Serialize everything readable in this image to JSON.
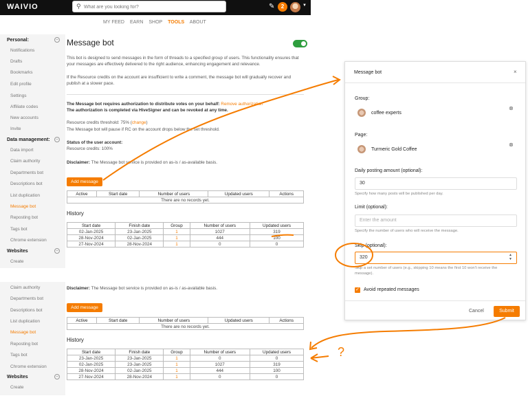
{
  "header": {
    "logo": "WAIVIO",
    "search_placeholder": "What are you looking for?",
    "notification_count": "2",
    "nav": [
      "MY FEED",
      "EARN",
      "SHOP",
      "TOOLS",
      "ABOUT"
    ],
    "nav_active": "TOOLS"
  },
  "sidebar": {
    "personal_title": "Personal:",
    "personal_items": [
      "Notifications",
      "Drafts",
      "Bookmarks",
      "Edit profile",
      "Settings",
      "Affiliate codes",
      "New accounts",
      "Invite"
    ],
    "data_title": "Data management:",
    "data_items": [
      "Data import",
      "Claim authority",
      "Departments bot",
      "Descriptions bot",
      "List duplication",
      "Message bot",
      "Reposting bot",
      "Tags bot",
      "Chrome extension"
    ],
    "active_item": "Message bot",
    "websites_title": "Websites",
    "websites_items": [
      "Create"
    ],
    "lower_items": [
      "Claim authority",
      "Departments bot",
      "Descriptions bot",
      "List duplication",
      "Message bot",
      "Reposting bot",
      "Tags bot",
      "Chrome extension"
    ],
    "lower_websites_title": "Websites",
    "lower_websites_items": [
      "Create"
    ]
  },
  "main": {
    "title": "Message bot",
    "intro1": "This bot is designed to send messages in the form of threads to a specified group of users. This functionality ensures that",
    "intro2": "your messages are effectively delivered to the right audience, enhancing engagement and relevance.",
    "intro3": "If the Resource credits on the account are insufficient to write a comment, the message bot will gradually recover and",
    "intro4": "publish at a slower pace.",
    "auth_text": "The Message bot requires authorization to distribute votes on your behalf:",
    "auth_link": "Remove authorization",
    "auth_text2": "The authorization is completed via HiveSigner and can be revoked at any time.",
    "threshold_label": "Resource credits threshold: 75% (",
    "threshold_link": "change",
    "threshold_end": ")",
    "threshold_note": "The Message bot will pause if RC on the account drops below the set threshold.",
    "status_title": "Status of the user account:",
    "status_value": "Resource credits: 100%",
    "disclaimer_label": "Disclaimer:",
    "disclaimer_text": "The Message bot service is provided on as-is / as-available basis.",
    "add_button": "Add message",
    "active_table": {
      "headers": [
        "Active",
        "Start date",
        "Number of users",
        "Updated users",
        "Actions"
      ],
      "empty": "There are no records yet."
    },
    "history_title": "History",
    "history_headers": [
      "Start date",
      "Finish date",
      "Group",
      "Number of users",
      "Updated users"
    ],
    "history_rows": [
      [
        "02-Jan-2025",
        "23-Jan-2025",
        "1",
        "1027",
        "319"
      ],
      [
        "28-Nov-2024",
        "02-Jan-2025",
        "1",
        "444",
        "100"
      ],
      [
        "27-Nov-2024",
        "28-Nov-2024",
        "1",
        "0",
        "0"
      ]
    ],
    "lower_disclaimer_label": "Disclaimer:",
    "lower_disclaimer_text": "The Message bot service is provided on as-is / as-available basis.",
    "lower_add_button": "Add message",
    "lower_history_title": "History",
    "lower_history_rows": [
      [
        "23-Jan-2025",
        "23-Jan-2025",
        "1",
        "0",
        "0"
      ],
      [
        "02-Jan-2025",
        "23-Jan-2025",
        "1",
        "1027",
        "319"
      ],
      [
        "28-Nov-2024",
        "02-Jan-2025",
        "1",
        "444",
        "100"
      ],
      [
        "27-Nov-2024",
        "28-Nov-2024",
        "1",
        "0",
        "0"
      ]
    ]
  },
  "modal": {
    "title": "Message bot",
    "close": "×",
    "group_label": "Group:",
    "group_value": "coffee experts",
    "page_label": "Page:",
    "page_value": "Turmeric Gold Coffee",
    "daily_label": "Daily posting amount (optional):",
    "daily_value": "30",
    "daily_hint": "Specify how many posts will be published per day.",
    "limit_label": "Limit (optional):",
    "limit_placeholder": "Enter the amount",
    "limit_hint": "Specify the number of users who will receive the message.",
    "skip_label": "Skip (optional):",
    "skip_value": "320",
    "skip_hint1": "Skip a set number of users (e.g., skipping 10 means the first 10 won't receive the",
    "skip_hint2": "message).",
    "avoid_label": "Avoid repeated messages",
    "cancel": "Cancel",
    "submit": "Submit"
  },
  "annotation": {
    "mark": "?",
    "color": "#f57c00"
  }
}
